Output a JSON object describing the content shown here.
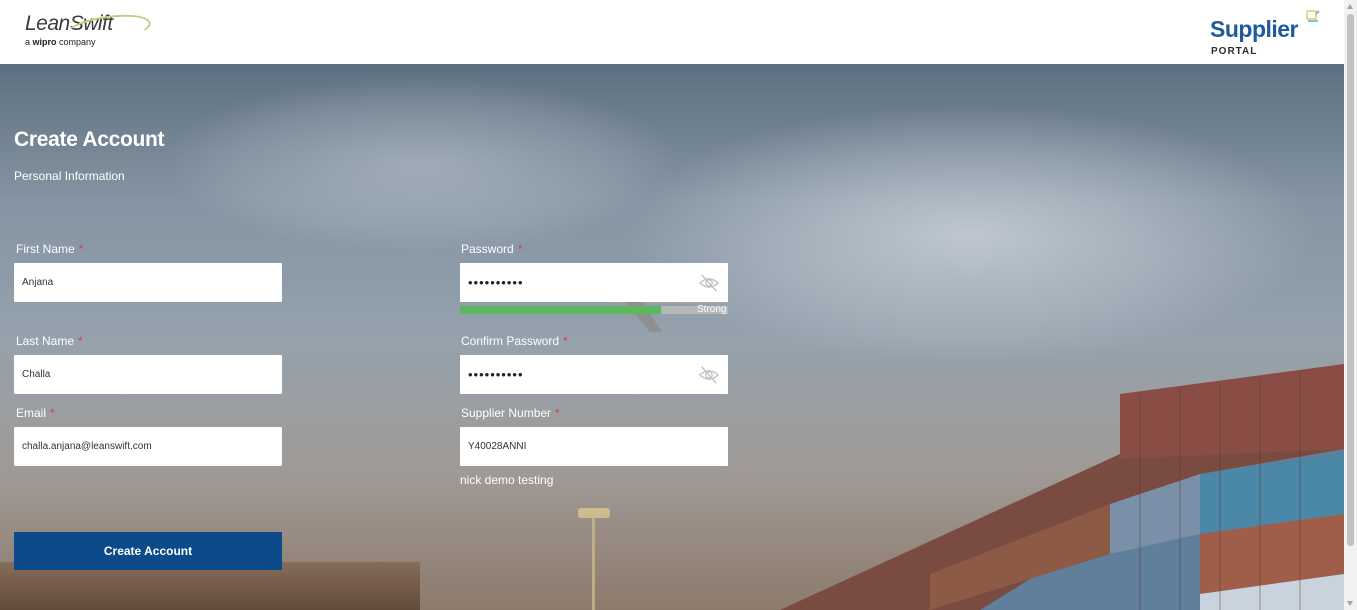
{
  "header": {
    "logo_left_brand": "LeanSwift",
    "logo_left_tag_prefix": "a ",
    "logo_left_tag_bold": "wipro",
    "logo_left_tag_suffix": " company",
    "logo_right_brand": "Supplier",
    "logo_right_sub": "PORTAL"
  },
  "page": {
    "title": "Create Account",
    "subtitle": "Personal Information"
  },
  "form": {
    "first_name": {
      "label": "First Name",
      "required": "*",
      "value": "Anjana"
    },
    "last_name": {
      "label": "Last Name",
      "required": "*",
      "value": "Challa"
    },
    "email": {
      "label": "Email",
      "required": "*",
      "value": "challa.anjana@leanswift.com"
    },
    "password": {
      "label": "Password",
      "required": "*",
      "value": "••••••••••",
      "strength_label": "Strong",
      "strength_fraction": 0.75
    },
    "confirm_password": {
      "label": "Confirm Password",
      "required": "*",
      "value": "••••••••••"
    },
    "supplier_number": {
      "label": "Supplier Number",
      "required": "*",
      "value": "Y40028ANNI",
      "supplier_name": "nick demo testing"
    },
    "submit_label": "Create Account"
  },
  "colors": {
    "button": "#0b4a8b",
    "strength": "#5cb85c",
    "required": "#e04040",
    "brand_blue": "#1f5a9c"
  },
  "icons": [
    "eye-slash-icon",
    "cart-icon"
  ]
}
